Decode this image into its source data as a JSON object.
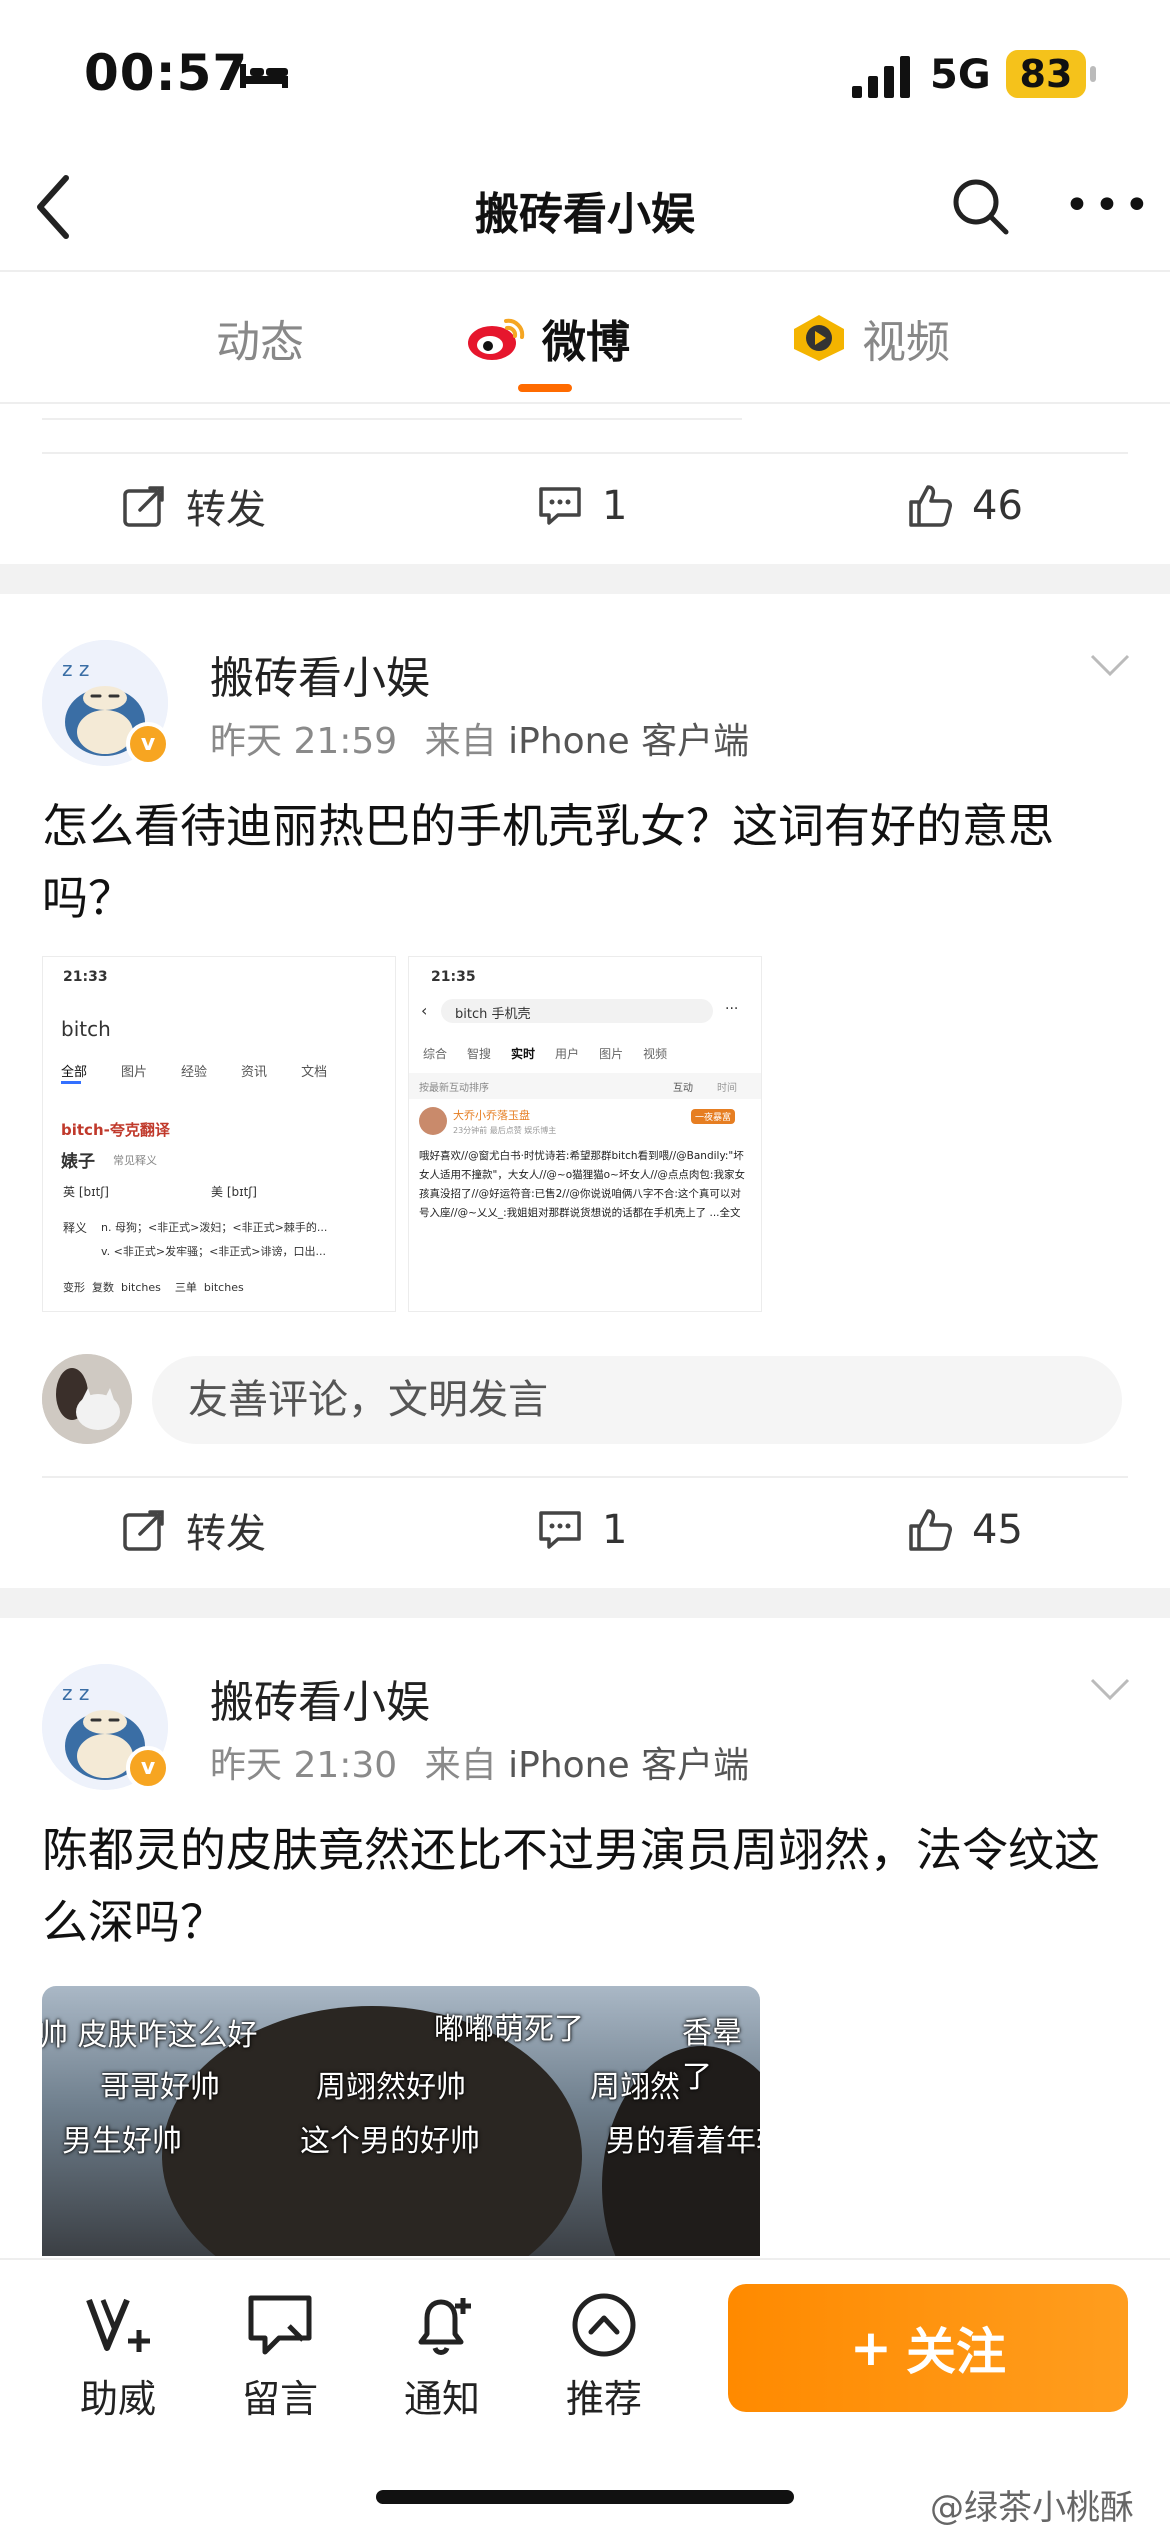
{
  "status_bar": {
    "time": "00:57",
    "network": "5G",
    "battery": "83"
  },
  "nav": {
    "title": "搬砖看小娱"
  },
  "tabs": [
    {
      "label": "动态"
    },
    {
      "label": "微博"
    },
    {
      "label": "视频"
    }
  ],
  "post0": {
    "repost_label": "转发",
    "comments": "1",
    "likes": "46"
  },
  "post1": {
    "author": "搬砖看小娱",
    "time": "昨天 21:59",
    "source_prefix": "来自",
    "source": "iPhone 客户端",
    "text": "怎么看待迪丽热巴的手机壳乳女？这词有好的意思吗？",
    "shot1": {
      "time": "21:33",
      "query": "bitch",
      "tabs": [
        "全部",
        "图片",
        "经验",
        "资讯",
        "文档"
      ],
      "title": "bitch-夸克翻译",
      "word": "婊子",
      "word_note": "常见释义",
      "uk": "英 [bɪtʃ]",
      "us": "美 [bɪtʃ]",
      "def_label": "释义",
      "def1": "n.  母狗；<非正式>泼妇；<非正式>棘手的...",
      "def2": "v.  <非正式>发牢骚；<非正式>诽谤，口出...",
      "forms": "变形  复数  bitches    三单  bitches"
    },
    "shot2": {
      "time": "21:35",
      "query": "bitch 手机壳",
      "tabs": [
        "综合",
        "智搜",
        "实时",
        "用户",
        "图片",
        "视频"
      ],
      "sort_label": "按最新互动排序",
      "filter1": "互动",
      "filter2": "时间",
      "user": "大乔小乔落玉盘",
      "user_meta": "23分钟前  最后点赞  娱乐博主",
      "badge": "一夜暴富",
      "body": "哦好喜欢//@窗尤白书·时忧诗若:希望那群bitch看到喂//@Bandily:\"坏女人适用不撞款\"，大女人//@~o猫狸猫o~坏女人//@点点肉包:我家女孩真没招了//@好运符音:已售2//@你说说咱俩八字不合:这个真可以对号入座//@~乂乂_:我姐姐对那群说货想说的话都在手机壳上了 ...全文"
    },
    "comment_placeholder": "友善评论，文明发言",
    "repost_label": "转发",
    "comments": "1",
    "likes": "45"
  },
  "post2": {
    "author": "搬砖看小娱",
    "time": "昨天 21:30",
    "source_prefix": "来自",
    "source": "iPhone 客户端",
    "text": "陈都灵的皮肤竟然还比不过男演员周翊然，法令纹这么深吗？",
    "captions": [
      "帅 皮肤咋这么好",
      "嘟嘟萌死了",
      "香晕了",
      "哥哥好帅",
      "周翊然好帅",
      "周翊然",
      "男生好帅",
      "这个男的好帅",
      "男的看着年轻"
    ]
  },
  "bottom_bar": {
    "items": [
      {
        "label": "助威"
      },
      {
        "label": "留言"
      },
      {
        "label": "通知"
      },
      {
        "label": "推荐"
      }
    ],
    "follow_label": "关注",
    "watermark": "@绿茶小桃酥"
  },
  "colors": {
    "accent": "#ff8200",
    "link": "#555555",
    "meta": "#8a8a8a"
  }
}
